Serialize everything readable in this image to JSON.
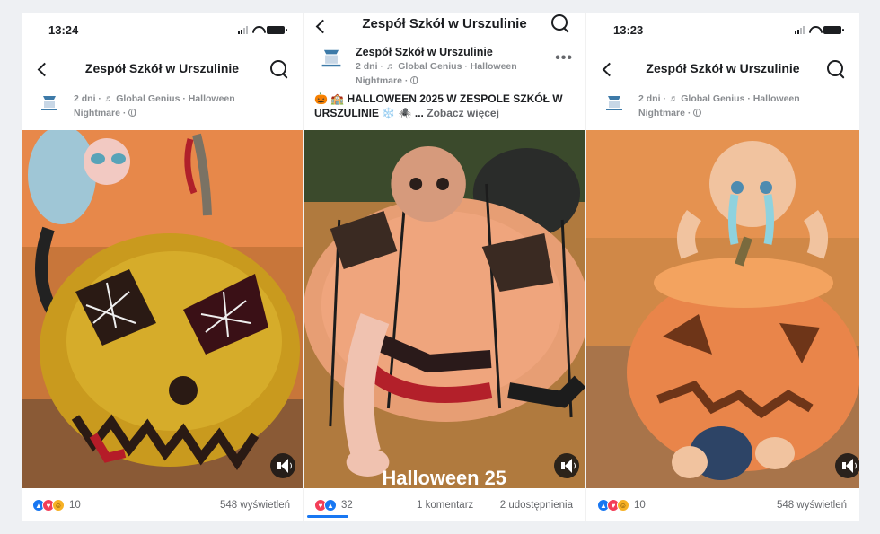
{
  "colors": {
    "accent": "#1877f2",
    "love": "#f33e58",
    "haha": "#f7b125",
    "pumpkin": "#f0955f"
  },
  "panels": [
    {
      "time": "13:24",
      "title": "Zespół Szkół w Urszulinie",
      "meta_line1": "2 dni · ♬ Global Genius · Halloween",
      "meta_line2": "Nightmare ·",
      "reaction_count": "10",
      "views": "548 wyświetleń",
      "icons": [
        "back-icon",
        "search-icon",
        "sound-icon"
      ]
    },
    {
      "title": "Zespół Szkół w Urszulinie",
      "page_name": "Zespół Szkół w Urszulinie",
      "meta_line1": "2 dni · ♬ Global Genius · Halloween",
      "meta_line2": "Nightmare ·",
      "caption": "🎃 🏫 HALLOWEEN 2025  W ZESPOLE SZKÓŁ W URSZULINIE ❄️ 🕷️ ...",
      "caption_more": "Zobacz więcej",
      "overlay_text": "Halloween 25",
      "reaction_count": "32",
      "comments": "1 komentarz",
      "shares": "2 udostępnienia",
      "icons": [
        "back-icon",
        "search-icon",
        "more-icon",
        "sound-icon"
      ]
    },
    {
      "time": "13:23",
      "title": "Zespół Szkół w Urszulinie",
      "meta_line1": "2 dni · ♬ Global Genius · Halloween",
      "meta_line2": "Nightmare ·",
      "reaction_count": "10",
      "views": "548 wyświetleń",
      "icons": [
        "back-icon",
        "search-icon",
        "sound-icon"
      ]
    }
  ]
}
